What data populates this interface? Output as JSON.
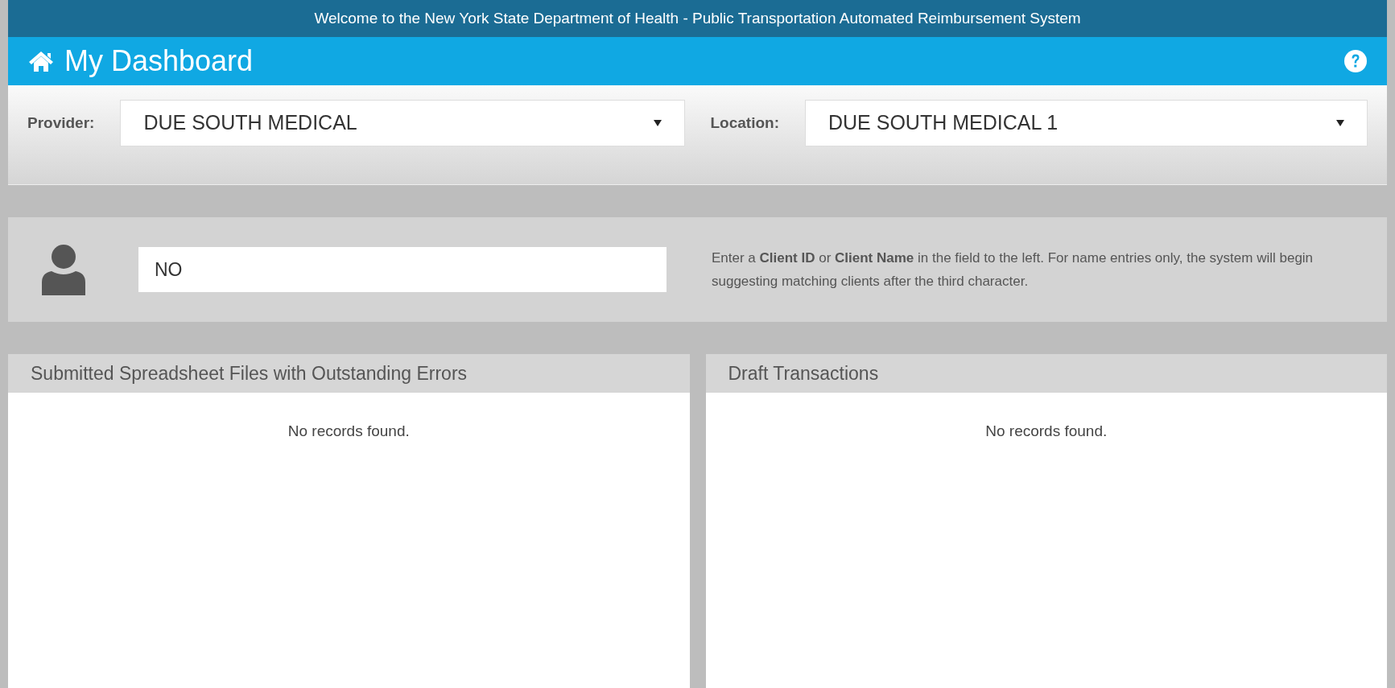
{
  "banner": {
    "text": "Welcome to the New York State Department of Health - Public Transportation Automated Reimbursement System"
  },
  "header": {
    "title": "My Dashboard"
  },
  "filters": [
    {
      "label": "Provider:",
      "value": "DUE SOUTH MEDICAL"
    },
    {
      "label": "Location:",
      "value": "DUE SOUTH MEDICAL 1"
    }
  ],
  "client_search": {
    "value": "NO",
    "help": "Enter a **Client ID** or **Client Name** in the field to the left. For name entries only, the system will begin suggesting matching clients after the third character."
  },
  "panels": [
    {
      "title": "Submitted Spreadsheet Files with Outstanding Errors",
      "empty_text": "No records found."
    },
    {
      "title": "Draft Transactions",
      "empty_text": "No records found."
    }
  ]
}
